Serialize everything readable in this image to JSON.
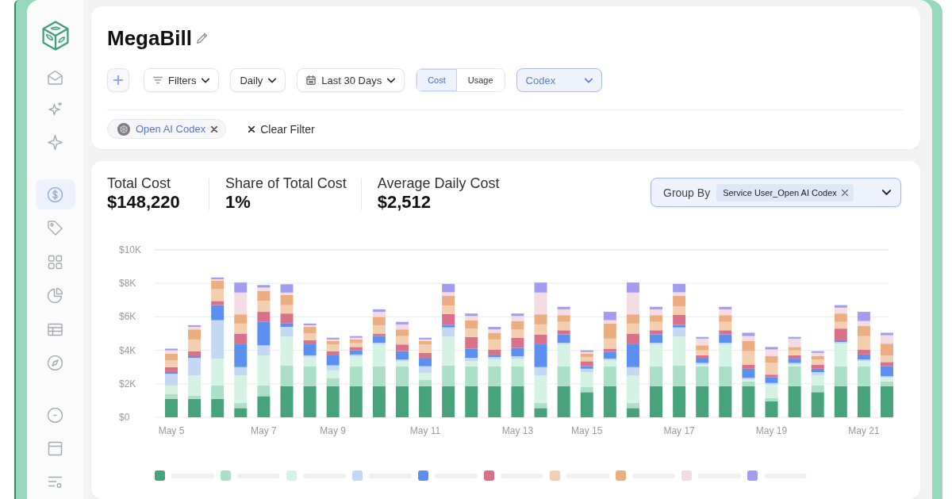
{
  "sidebar": {
    "sections": [
      {
        "items": [
          {
            "selected": false
          },
          {
            "selected": false
          },
          {
            "selected": false
          }
        ]
      },
      {
        "items": [
          {
            "selected": true
          },
          {
            "selected": false
          },
          {
            "selected": false
          },
          {
            "selected": false
          },
          {
            "selected": false
          },
          {
            "selected": false
          }
        ]
      },
      {
        "items": [
          {
            "selected": false
          },
          {
            "selected": false
          },
          {
            "selected": false
          }
        ]
      }
    ]
  },
  "header": {
    "title": "MegaBill"
  },
  "toolbar": {
    "filters": {
      "label": "Filters"
    },
    "granularity": {
      "value": "Daily"
    },
    "date_range": {
      "value": "Last 30 Days"
    },
    "metric_toggle": [
      {
        "label": "Cost",
        "selected": true
      },
      {
        "label": "Usage",
        "selected": false
      }
    ],
    "service_select": {
      "value": "Codex"
    }
  },
  "active_filters": {
    "chips": [
      {
        "label": "Open AI Codex"
      }
    ],
    "clear_label": "Clear Filter"
  },
  "summary": {
    "metrics": [
      {
        "label": "Total Cost",
        "value": "$148,220"
      },
      {
        "label": "Share of Total Cost",
        "value": "1%"
      },
      {
        "label": "Average Daily Cost",
        "value": "$2,512"
      }
    ]
  },
  "group_by": {
    "label": "Group By",
    "chips": [
      {
        "label": "Service User_Open AI Codex"
      }
    ]
  },
  "chart": {
    "chart_data": {
      "type": "bar",
      "stacked": true,
      "grid": true,
      "categories": [
        "May 5",
        null,
        null,
        null,
        "May 7",
        null,
        null,
        "May 9",
        null,
        null,
        null,
        "May 11",
        null,
        null,
        null,
        "May 13",
        null,
        null,
        "May 15",
        null,
        null,
        null,
        "May 17",
        null,
        null,
        null,
        "May 19",
        null,
        null,
        null,
        "May 21",
        null
      ],
      "ylim": [
        0,
        10000
      ],
      "yticks": [
        {
          "value": 0,
          "label": "$0"
        },
        {
          "value": 2000,
          "label": "$2K"
        },
        {
          "value": 4000,
          "label": "$4K"
        },
        {
          "value": 6000,
          "label": "$6K"
        },
        {
          "value": 8000,
          "label": "$8K"
        },
        {
          "value": 10000,
          "label": "$10K"
        }
      ],
      "series": [
        {
          "color": "#46a37c",
          "values": [
            1100,
            1100,
            1100,
            550,
            1260,
            1850,
            1850,
            1850,
            1850,
            1850,
            1850,
            1850,
            1850,
            1850,
            1850,
            1850,
            550,
            1850,
            1500,
            1850,
            550,
            1850,
            1850,
            1850,
            1850,
            1850,
            950,
            1850,
            1500,
            1850,
            1850,
            1850
          ]
        },
        {
          "color": "#acdfc7",
          "values": [
            300,
            200,
            800,
            300,
            640,
            1230,
            1200,
            500,
            1200,
            1200,
            1200,
            400,
            1230,
            1200,
            1200,
            1200,
            300,
            1200,
            300,
            1200,
            300,
            1200,
            1230,
            1200,
            1200,
            300,
            200,
            1200,
            400,
            1200,
            1200,
            300
          ]
        },
        {
          "color": "#d5f3e5",
          "values": [
            500,
            1200,
            1600,
            1650,
            1800,
            1740,
            550,
            450,
            600,
            1300,
            300,
            400,
            1740,
            300,
            400,
            450,
            1650,
            1300,
            900,
            350,
            1650,
            1300,
            1740,
            100,
            1300,
            100,
            800,
            100,
            600,
            1350,
            300,
            200
          ]
        },
        {
          "color": "#c4d8f4",
          "values": [
            700,
            1050,
            2300,
            500,
            600,
            580,
            100,
            300,
            100,
            100,
            100,
            400,
            550,
            200,
            150,
            150,
            500,
            100,
            200,
            100,
            500,
            100,
            550,
            100,
            100,
            100,
            100,
            100,
            200,
            100,
            100,
            100
          ]
        },
        {
          "color": "#5b8ff0",
          "values": [
            100,
            100,
            900,
            1400,
            1400,
            200,
            700,
            600,
            250,
            400,
            500,
            500,
            150,
            550,
            100,
            500,
            1400,
            500,
            150,
            400,
            1400,
            500,
            150,
            300,
            500,
            550,
            350,
            250,
            200,
            100,
            300,
            600
          ]
        },
        {
          "color": "#d9718b",
          "values": [
            300,
            300,
            250,
            600,
            600,
            600,
            200,
            250,
            200,
            150,
            400,
            300,
            650,
            700,
            350,
            600,
            550,
            250,
            300,
            200,
            600,
            250,
            600,
            150,
            250,
            250,
            150,
            200,
            250,
            700,
            300,
            250
          ]
        },
        {
          "color": "#f3cfb0",
          "values": [
            400,
            700,
            700,
            600,
            650,
            500,
            400,
            400,
            250,
            500,
            500,
            500,
            500,
            500,
            600,
            500,
            600,
            500,
            250,
            600,
            600,
            500,
            500,
            300,
            500,
            800,
            700,
            300,
            300,
            400,
            800,
            400
          ]
        },
        {
          "color": "#eaae80",
          "values": [
            400,
            600,
            500,
            550,
            600,
            600,
            400,
            200,
            200,
            500,
            400,
            200,
            600,
            500,
            400,
            500,
            600,
            400,
            200,
            900,
            550,
            400,
            650,
            300,
            400,
            600,
            400,
            200,
            200,
            500,
            600,
            700
          ]
        },
        {
          "color": "#f5dce4",
          "values": [
            200,
            150,
            100,
            1300,
            200,
            150,
            100,
            100,
            100,
            300,
            300,
            100,
            200,
            250,
            200,
            300,
            1300,
            350,
            100,
            200,
            1300,
            350,
            200,
            400,
            350,
            300,
            400,
            500,
            200,
            350,
            300,
            500
          ]
        },
        {
          "color": "#a49cef",
          "values": [
            100,
            100,
            100,
            600,
            150,
            500,
            100,
            100,
            100,
            150,
            150,
            100,
            500,
            150,
            150,
            150,
            600,
            150,
            100,
            500,
            600,
            150,
            500,
            100,
            150,
            200,
            150,
            100,
            100,
            150,
            550,
            150
          ]
        }
      ]
    }
  }
}
